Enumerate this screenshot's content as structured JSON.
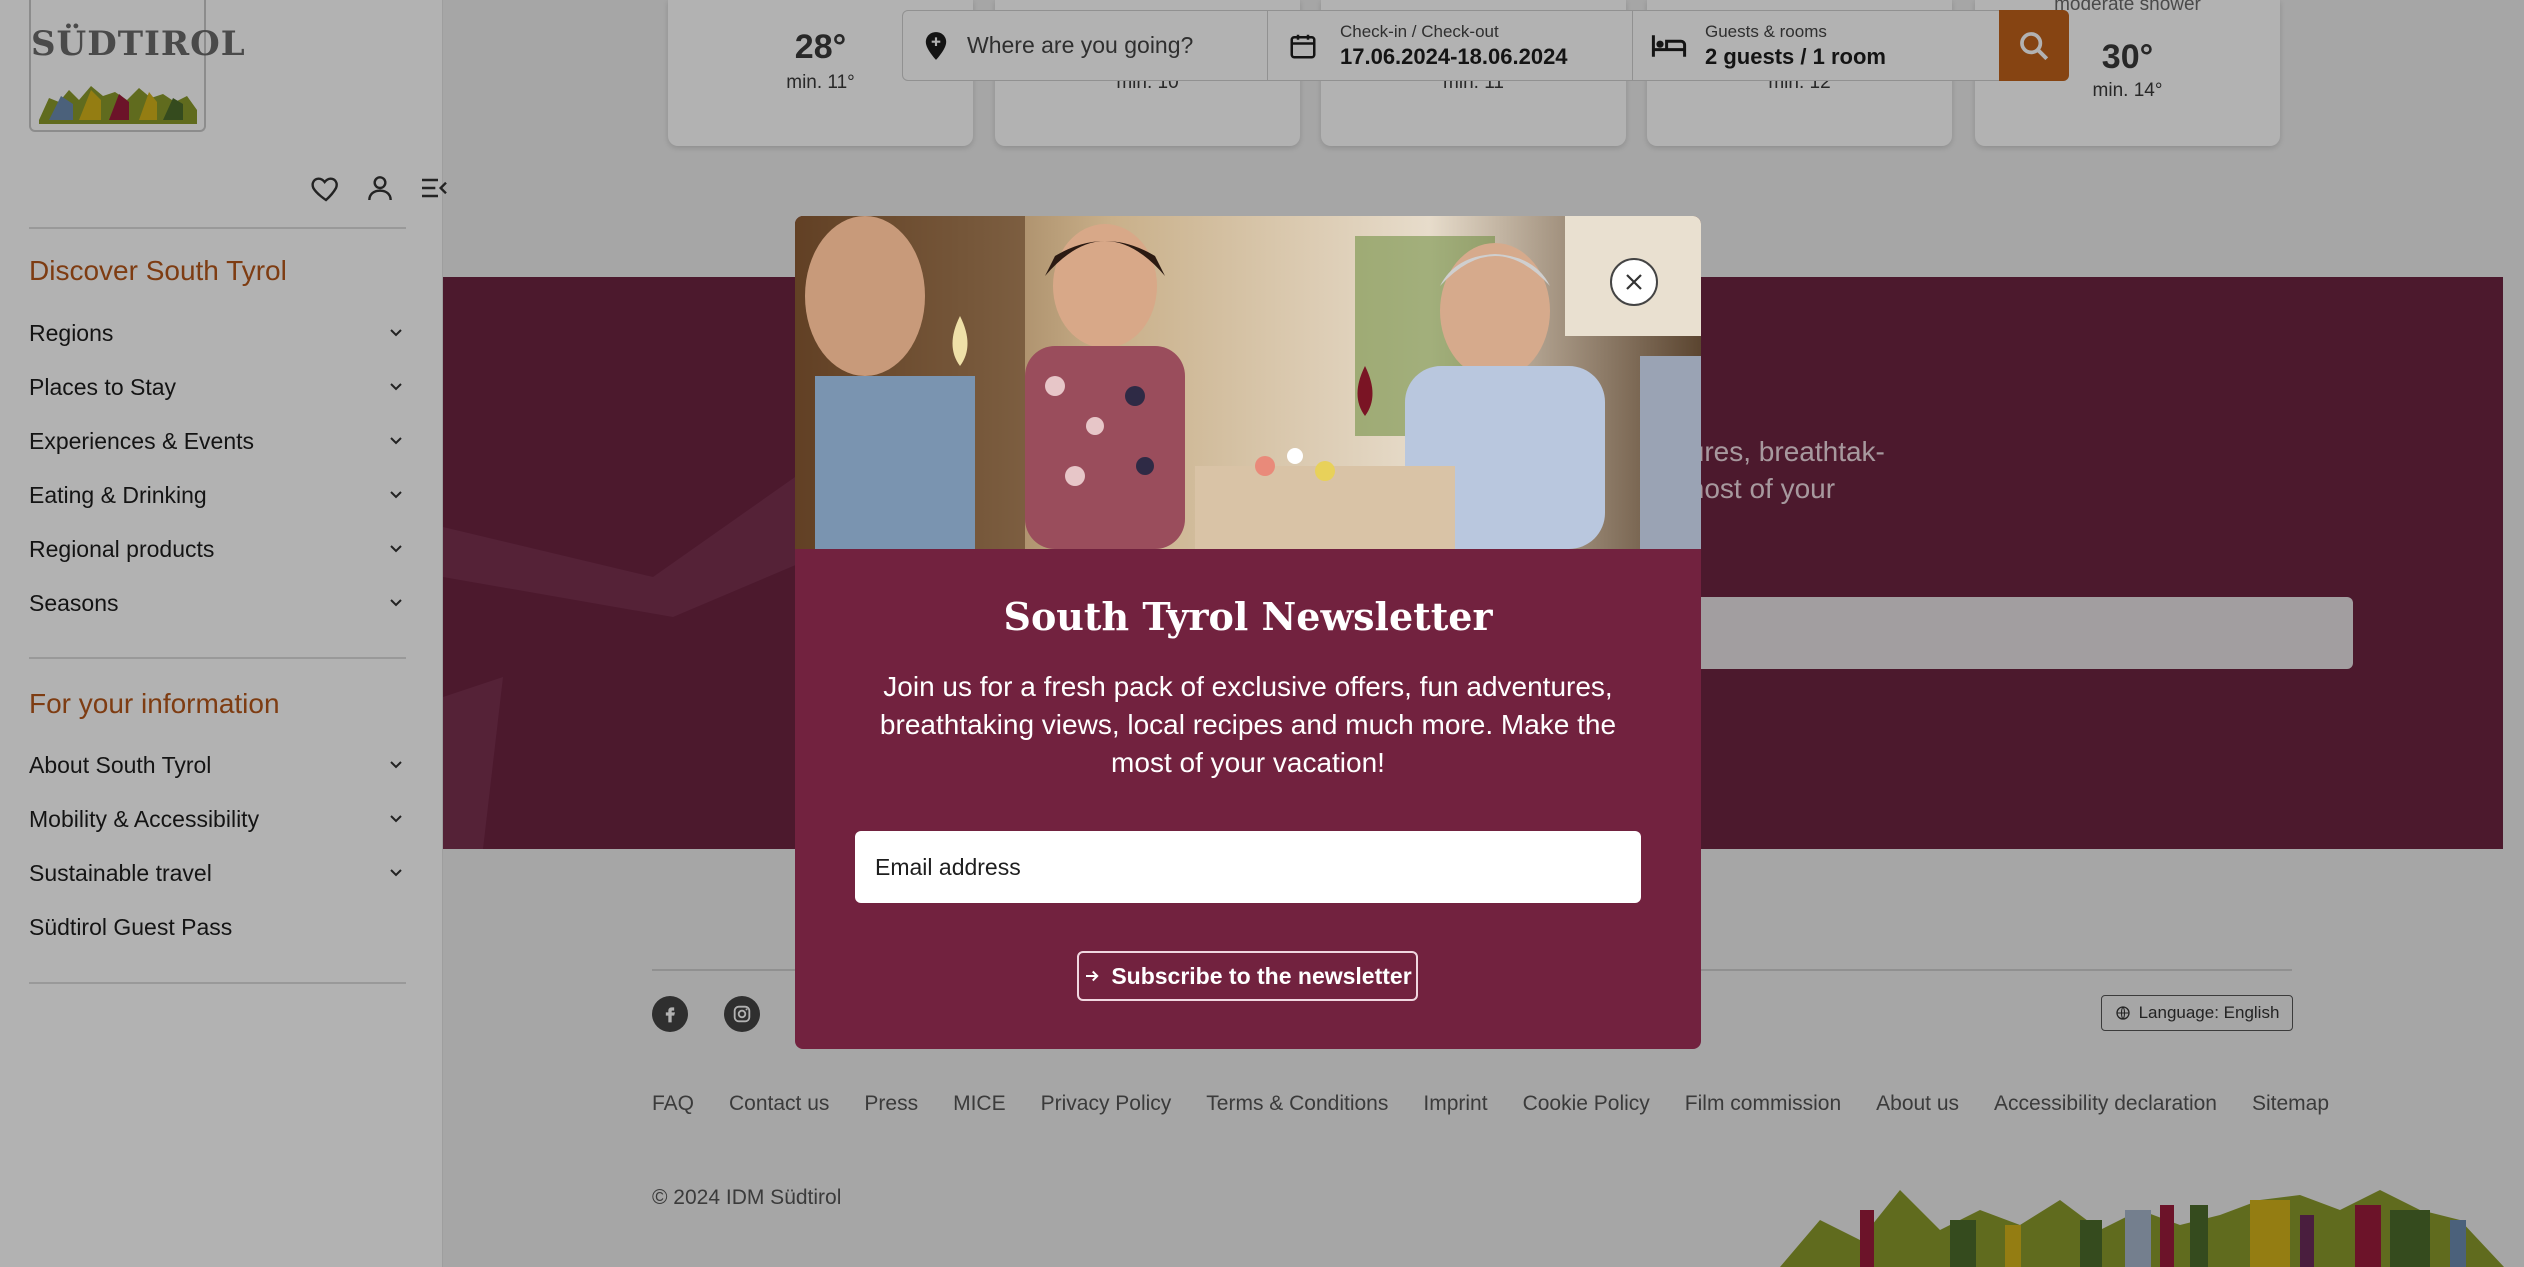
{
  "brand": {
    "logo_text": "SÜDTIROL"
  },
  "sidebar": {
    "icons": [
      "heart-icon",
      "user-icon",
      "menu-collapse-icon"
    ],
    "section1_title": "Discover South Tyrol",
    "section1_items": [
      {
        "label": "Regions"
      },
      {
        "label": "Places to Stay"
      },
      {
        "label": "Experiences & Events"
      },
      {
        "label": "Eating & Drinking"
      },
      {
        "label": "Regional products"
      },
      {
        "label": "Seasons"
      }
    ],
    "section2_title": "For your information",
    "section2_items": [
      {
        "label": "About South Tyrol"
      },
      {
        "label": "Mobility & Accessibility"
      },
      {
        "label": "Sustainable travel"
      },
      {
        "label": "Südtirol Guest Pass"
      }
    ]
  },
  "weather": [
    {
      "temp": "28°",
      "min": "min. 11°"
    },
    {
      "temp": "",
      "min": "min. 10"
    },
    {
      "temp": "",
      "min": "min. 11"
    },
    {
      "temp": "",
      "min": "min. 12"
    },
    {
      "condition": "moderate shower",
      "temp": "30°",
      "min": "min. 14°"
    }
  ],
  "search": {
    "where_placeholder": "Where are you going?",
    "dates_label": "Check-in / Check-out",
    "dates_value": "17.06.2024-18.06.2024",
    "guests_label": "Guests & rooms",
    "guests_value": "2 guests / 1 room"
  },
  "background_band": {
    "text_line1": "tures, breathtak-",
    "text_line2": "most of your"
  },
  "modal": {
    "title": "South Tyrol Newsletter",
    "text": "Join us for a fresh pack of exclusive offers, fun adventures, breathtaking views, local recipes and much more. Make the most of your vacation!",
    "email_placeholder": "Email address",
    "subscribe_label": "Subscribe to the newsletter"
  },
  "footer": {
    "language_label": "Language: English",
    "links": [
      "FAQ",
      "Contact us",
      "Press",
      "MICE",
      "Privacy Policy",
      "Terms & Conditions",
      "Imprint",
      "Cookie Policy",
      "Film commission",
      "About us",
      "Accessibility declaration",
      "Sitemap"
    ],
    "copyright": "© 2024 IDM Südtirol"
  },
  "colors": {
    "accent": "#b5571a",
    "search_button": "#c0621b",
    "modal_bg": "#72223f",
    "band_bg": "#6d2441"
  }
}
